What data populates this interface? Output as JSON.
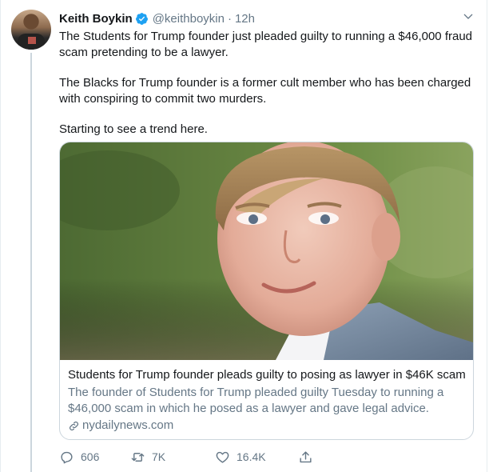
{
  "author": {
    "display_name": "Keith Boykin",
    "handle": "@keithboykin",
    "separator": "·",
    "time": "12h"
  },
  "tweet": {
    "paragraphs": [
      "The Students for Trump founder just pleaded guilty to running a $46,000 fraud scam pretending to be a lawyer.",
      "The Blacks for Trump founder is a former cult member who has been charged with conspiring to commit two murders.",
      "Starting to see a trend here."
    ]
  },
  "card": {
    "title": "Students for Trump founder pleads guilty to posing as lawyer in $46K scam",
    "description": "The founder of Students for Trump pleaded guilty Tuesday to running a $46,000 scam in which he posed as a lawyer and gave legal advice.",
    "domain": "nydailynews.com"
  },
  "actions": {
    "replies": "606",
    "retweets": "7K",
    "likes": "16.4K"
  },
  "icons": {
    "verified": "verified-badge-icon",
    "caret": "chevron-down-icon",
    "link": "link-icon",
    "reply": "reply-icon",
    "retweet": "retweet-icon",
    "like": "heart-icon",
    "share": "share-icon"
  },
  "colors": {
    "verified": "#1da1f2",
    "secondary_text": "#657786",
    "primary_text": "#14171a",
    "border": "#ccd6dd"
  }
}
